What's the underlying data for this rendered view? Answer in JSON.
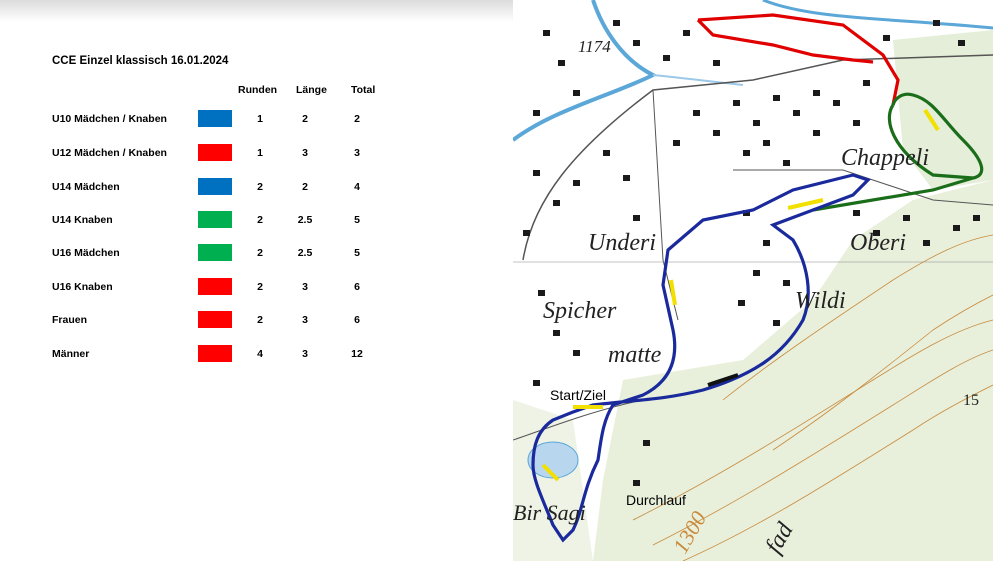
{
  "legend": {
    "title": "CCE Einzel klassisch 16.01.2024",
    "headers": {
      "runden": "Runden",
      "laenge": "Länge",
      "total": "Total"
    },
    "rows": [
      {
        "category": "U10 Mädchen / Knaben",
        "color": "#0070c0",
        "runden": "1",
        "laenge": "2",
        "total": "2"
      },
      {
        "category": "U12 Mädchen / Knaben",
        "color": "#ff0000",
        "runden": "1",
        "laenge": "3",
        "total": "3"
      },
      {
        "category": "U14 Mädchen",
        "color": "#0070c0",
        "runden": "2",
        "laenge": "2",
        "total": "4"
      },
      {
        "category": "U14 Knaben",
        "color": "#00b050",
        "runden": "2",
        "laenge": "2.5",
        "total": "5"
      },
      {
        "category": "U16 Mädchen",
        "color": "#00b050",
        "runden": "2",
        "laenge": "2.5",
        "total": "5"
      },
      {
        "category": "U16  Knaben",
        "color": "#ff0000",
        "runden": "2",
        "laenge": "3",
        "total": "6"
      },
      {
        "category": "Frauen",
        "color": "#ff0000",
        "runden": "2",
        "laenge": "3",
        "total": "6"
      },
      {
        "category": "Männer",
        "color": "#ff0000",
        "runden": "4",
        "laenge": "3",
        "total": "12"
      }
    ]
  },
  "map": {
    "labels": {
      "elevation_top": "1174",
      "place_chappeli": "Chappeli",
      "place_underi": "Underi",
      "place_oberi": "Oberi",
      "place_spicher": "Spicher",
      "place_matte": "matte",
      "place_wildi": "Wildi",
      "place_saegi": "Bir Sagi",
      "elevation_1300": "1300",
      "elevation_15": "15",
      "fad": "fad",
      "start": "Start/Ziel",
      "durchlauf": "Durchlauf"
    },
    "route_colors": {
      "blue": "#1a2a9c",
      "red": "#e00000",
      "green": "#1a6e1a",
      "marker": "#f2e000"
    }
  }
}
